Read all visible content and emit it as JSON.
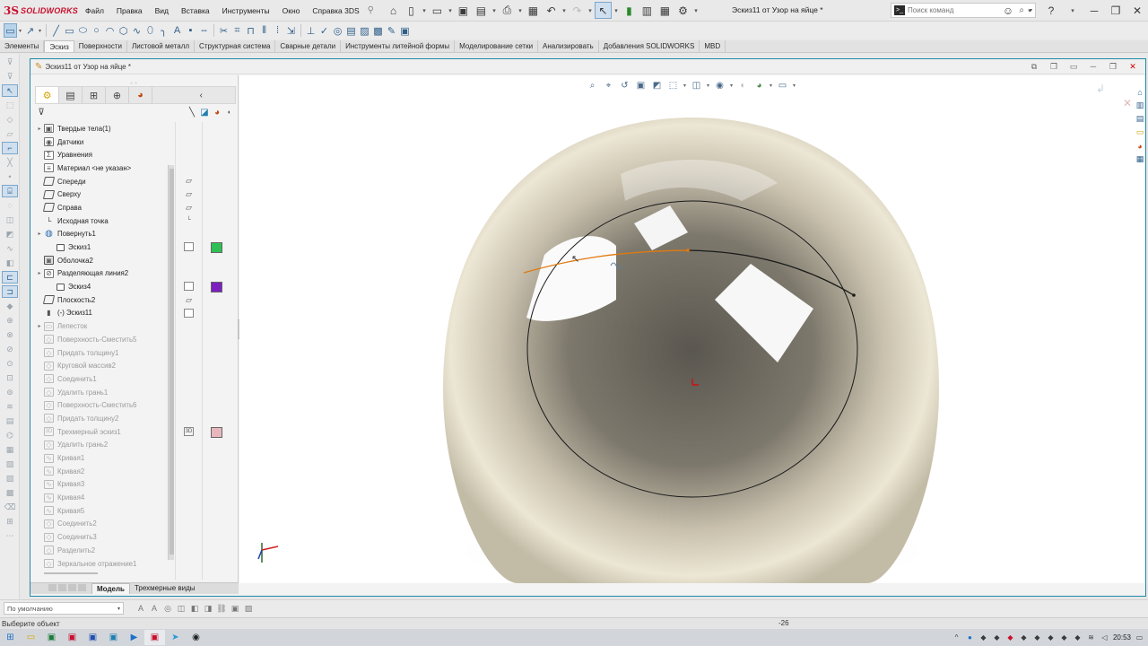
{
  "app": {
    "brand_ds": "3S",
    "brand_name": "SOLIDWORKS",
    "document_title": "Эскиз11 от Узор на яйце *"
  },
  "menu": [
    "Файл",
    "Правка",
    "Вид",
    "Вставка",
    "Инструменты",
    "Окно",
    "Справка 3DS"
  ],
  "search": {
    "placeholder": "Поиск команд"
  },
  "tabs": [
    {
      "label": "Элементы",
      "active": false
    },
    {
      "label": "Эскиз",
      "active": true
    },
    {
      "label": "Поверхности",
      "active": false
    },
    {
      "label": "Листовой металл",
      "active": false
    },
    {
      "label": "Структурная система",
      "active": false
    },
    {
      "label": "Сварные детали",
      "active": false
    },
    {
      "label": "Инструменты литейной формы",
      "active": false
    },
    {
      "label": "Моделирование сетки",
      "active": false
    },
    {
      "label": "Анализировать",
      "active": false
    },
    {
      "label": "Добавления SOLIDWORKS",
      "active": false
    },
    {
      "label": "MBD",
      "active": false
    }
  ],
  "document_tab": {
    "title": "Эскиз11 от Узор на яйце *"
  },
  "feature_tree": {
    "items": [
      {
        "label": "Твердые тела(1)",
        "icon": "solid-bodies-icon",
        "glyph": "▣",
        "expandable": true,
        "level": 0,
        "suppressed": false
      },
      {
        "label": "Датчики",
        "icon": "sensors-icon",
        "glyph": "◉",
        "expandable": false,
        "level": 0,
        "suppressed": false
      },
      {
        "label": "Уравнения",
        "icon": "equations-icon",
        "glyph": "Σ",
        "expandable": false,
        "level": 0,
        "suppressed": false
      },
      {
        "label": "Материал <не указан>",
        "icon": "material-icon",
        "glyph": "≡",
        "expandable": false,
        "level": 0,
        "suppressed": false
      },
      {
        "label": "Спереди",
        "icon": "plane-icon",
        "glyph": "",
        "expandable": false,
        "level": 0,
        "suppressed": false
      },
      {
        "label": "Сверху",
        "icon": "plane-icon",
        "glyph": "",
        "expandable": false,
        "level": 0,
        "suppressed": false
      },
      {
        "label": "Справа",
        "icon": "plane-icon",
        "glyph": "",
        "expandable": false,
        "level": 0,
        "suppressed": false
      },
      {
        "label": "Исходная точка",
        "icon": "origin-icon",
        "glyph": "└",
        "expandable": false,
        "level": 0,
        "suppressed": false
      },
      {
        "label": "Повернуть1",
        "icon": "revolve-icon",
        "glyph": "◍",
        "expandable": true,
        "level": 0,
        "suppressed": false
      },
      {
        "label": "Эскиз1",
        "icon": "sketch-icon",
        "glyph": "",
        "expandable": false,
        "level": 1,
        "suppressed": false
      },
      {
        "label": "Оболочка2",
        "icon": "shell-icon",
        "glyph": "◙",
        "expandable": false,
        "level": 0,
        "suppressed": false
      },
      {
        "label": "Разделяющая линия2",
        "icon": "split-line-icon",
        "glyph": "⊘",
        "expandable": true,
        "level": 0,
        "suppressed": false
      },
      {
        "label": "Эскиз4",
        "icon": "sketch-icon",
        "glyph": "",
        "expandable": false,
        "level": 1,
        "suppressed": false
      },
      {
        "label": "Плоскость2",
        "icon": "plane-icon",
        "glyph": "",
        "expandable": false,
        "level": 0,
        "suppressed": false
      },
      {
        "label": "(-) Эскиз11",
        "icon": "sketch-active-icon",
        "glyph": "▮",
        "expandable": false,
        "level": 0,
        "suppressed": false
      },
      {
        "label": "Лепесток",
        "icon": "folder-icon",
        "glyph": "▭",
        "expandable": true,
        "level": 0,
        "suppressed": true
      },
      {
        "label": "Поверхность-Сместить5",
        "icon": "surface-offset-icon",
        "glyph": "◇",
        "expandable": false,
        "level": 0,
        "suppressed": true
      },
      {
        "label": "Придать толщину1",
        "icon": "thicken-icon",
        "glyph": "◇",
        "expandable": false,
        "level": 0,
        "suppressed": true
      },
      {
        "label": "Круговой массив2",
        "icon": "circular-pattern-icon",
        "glyph": "◇",
        "expandable": false,
        "level": 0,
        "suppressed": true
      },
      {
        "label": "Соединить1",
        "icon": "combine-icon",
        "glyph": "◇",
        "expandable": false,
        "level": 0,
        "suppressed": true
      },
      {
        "label": "Удалить грань1",
        "icon": "delete-face-icon",
        "glyph": "◇",
        "expandable": false,
        "level": 0,
        "suppressed": true
      },
      {
        "label": "Поверхность-Сместить6",
        "icon": "surface-offset-icon",
        "glyph": "◇",
        "expandable": false,
        "level": 0,
        "suppressed": true
      },
      {
        "label": "Придать толщину2",
        "icon": "thicken-icon",
        "glyph": "◇",
        "expandable": false,
        "level": 0,
        "suppressed": true
      },
      {
        "label": "Трехмерный эскиз1",
        "icon": "3d-sketch-icon",
        "glyph": "3D",
        "expandable": false,
        "level": 0,
        "suppressed": true
      },
      {
        "label": "Удалить грань2",
        "icon": "delete-face-icon",
        "glyph": "◇",
        "expandable": false,
        "level": 0,
        "suppressed": true
      },
      {
        "label": "Кривая1",
        "icon": "curve-icon",
        "glyph": "∿",
        "expandable": false,
        "level": 0,
        "suppressed": true
      },
      {
        "label": "Кривая2",
        "icon": "curve-icon",
        "glyph": "∿",
        "expandable": false,
        "level": 0,
        "suppressed": true
      },
      {
        "label": "Кривая3",
        "icon": "curve-icon",
        "glyph": "∿",
        "expandable": false,
        "level": 0,
        "suppressed": true
      },
      {
        "label": "Кривая4",
        "icon": "curve-icon",
        "glyph": "∿",
        "expandable": false,
        "level": 0,
        "suppressed": true
      },
      {
        "label": "Кривая5",
        "icon": "curve-icon",
        "glyph": "∿",
        "expandable": false,
        "level": 0,
        "suppressed": true
      },
      {
        "label": "Соединить2",
        "icon": "combine-icon",
        "glyph": "◇",
        "expandable": false,
        "level": 0,
        "suppressed": true
      },
      {
        "label": "Соединить3",
        "icon": "combine-icon",
        "glyph": "◇",
        "expandable": false,
        "level": 0,
        "suppressed": true
      },
      {
        "label": "Разделить2",
        "icon": "split-icon",
        "glyph": "◇",
        "expandable": false,
        "level": 0,
        "suppressed": true
      },
      {
        "label": "Зеркальное отражение1",
        "icon": "mirror-icon",
        "glyph": "◇",
        "expandable": false,
        "level": 0,
        "suppressed": true
      }
    ]
  },
  "side_markers": [
    {
      "row": 4,
      "col": 1,
      "kind": "plane"
    },
    {
      "row": 5,
      "col": 1,
      "kind": "plane"
    },
    {
      "row": 6,
      "col": 1,
      "kind": "plane"
    },
    {
      "row": 7,
      "col": 1,
      "kind": "origin"
    },
    {
      "row": 9,
      "col": 1,
      "kind": "box"
    },
    {
      "row": 9,
      "col": 2,
      "kind": "swatch",
      "color": "#2fbf54"
    },
    {
      "row": 12,
      "col": 1,
      "kind": "box"
    },
    {
      "row": 12,
      "col": 2,
      "kind": "swatch",
      "color": "#7b1fbf"
    },
    {
      "row": 13,
      "col": 1,
      "kind": "plane"
    },
    {
      "row": 14,
      "col": 1,
      "kind": "box"
    },
    {
      "row": 23,
      "col": 1,
      "kind": "text3d",
      "text": "3D"
    },
    {
      "row": 23,
      "col": 2,
      "kind": "swatch",
      "color": "#e8b7bd"
    }
  ],
  "model_tabs": [
    {
      "label": "Модель",
      "active": true
    },
    {
      "label": "Трехмерные виды",
      "active": false
    }
  ],
  "config": {
    "selected": "По умолчанию"
  },
  "status": {
    "message": "Выберите объект",
    "value": "-26"
  },
  "clock": {
    "time": "20:53"
  },
  "colors": {
    "accent": "#1f8aa6",
    "brand": "#c8102e",
    "selected_curve": "#e07a10",
    "sketch_line": "#1a1a1a",
    "origin": "#d01010"
  }
}
